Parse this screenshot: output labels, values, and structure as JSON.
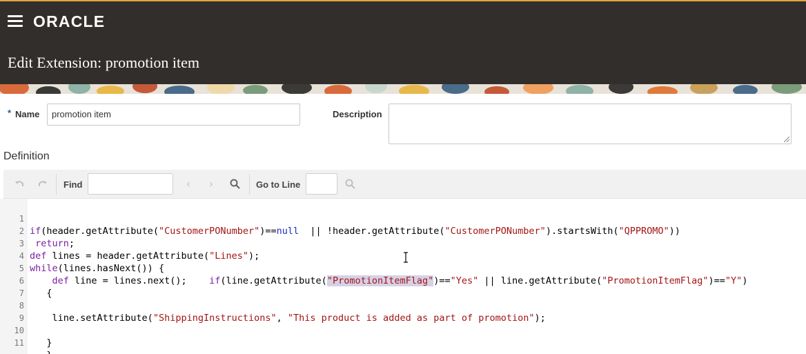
{
  "header": {
    "menu_icon": "hamburger-menu-icon",
    "logo": "ORACLE",
    "title": "Edit Extension: promotion item"
  },
  "form": {
    "required_marker": "*",
    "name_label": "Name",
    "name_value": "promotion item",
    "description_label": "Description",
    "description_value": "",
    "definition_label": "Definition"
  },
  "toolbar": {
    "undo_icon": "undo-icon",
    "redo_icon": "redo-icon",
    "find_label": "Find",
    "find_value": "",
    "prev_icon": "chevron-left-icon",
    "next_icon": "chevron-right-icon",
    "search_icon": "search-icon",
    "goto_label": "Go to Line",
    "goto_value": "",
    "goto_search_icon": "search-icon"
  },
  "editor": {
    "line_numbers": [
      "1",
      "2",
      "3",
      "4",
      "5",
      "6",
      "7",
      "8",
      "9",
      "10",
      "11"
    ],
    "lines": [
      "if(header.getAttribute(\"CustomerPONumber\")==null  || !header.getAttribute(\"CustomerPONumber\").startsWith(\"QPPROMO\"))",
      " return;",
      "def lines = header.getAttribute(\"Lines\");",
      "while(lines.hasNext()) {",
      "    def line = lines.next();    if(line.getAttribute(\"PromotionItemFlag\")==\"Yes\" || line.getAttribute(\"PromotionItemFlag\")==\"Y\")",
      "   {",
      "",
      "    line.setAttribute(\"ShippingInstructions\", \"This product is added as part of promotion\");",
      "",
      "   }",
      "   }"
    ]
  },
  "colors": {
    "header_bg": "#322e2b",
    "accent_top": "#e0a640",
    "keyword": "#7a1fa2",
    "string": "#a31515",
    "selection": "#d6d1e6"
  }
}
